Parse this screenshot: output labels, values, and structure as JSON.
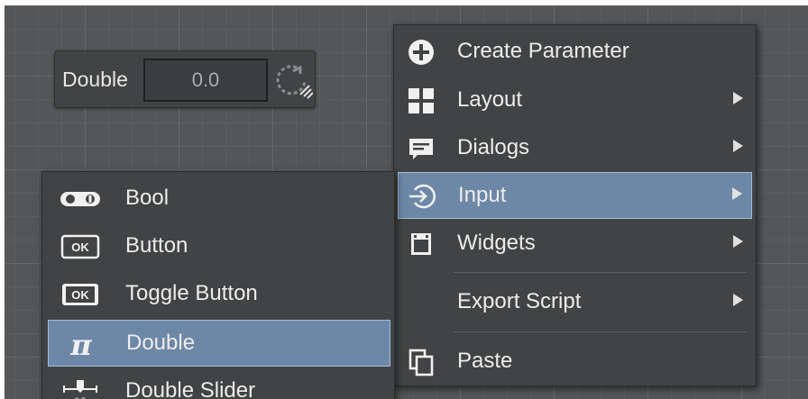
{
  "parameter": {
    "label": "Double",
    "value": "0.0",
    "spinner_icon": "rotate-icon"
  },
  "main_menu": {
    "items": [
      {
        "label": "Create Parameter",
        "icon": "plus-circle-icon"
      },
      {
        "label": "Layout",
        "icon": "grid-icon"
      },
      {
        "label": "Dialogs",
        "icon": "dialog-icon"
      },
      {
        "label": "Input",
        "icon": "input-icon"
      },
      {
        "label": "Widgets",
        "icon": "widget-icon"
      },
      {
        "label": "Export Script"
      },
      {
        "label": "Paste",
        "icon": "paste-icon"
      }
    ],
    "active_item": "Input"
  },
  "sub_menu": {
    "items": [
      {
        "label": "Bool",
        "icon": "toggle-icon"
      },
      {
        "label": "Button",
        "icon": "ok-button-icon",
        "icon_text": "OK"
      },
      {
        "label": "Toggle Button",
        "icon": "ok-toggle-icon",
        "icon_text": "OK"
      },
      {
        "label": "Double",
        "icon": "pi-icon",
        "icon_text": "π"
      },
      {
        "label": "Double Slider",
        "icon": "slider-icon"
      }
    ],
    "active_item": "Double"
  },
  "colors": {
    "menu_bg": "#414344",
    "highlight": "#6d88a7",
    "canvas": "#545657"
  }
}
